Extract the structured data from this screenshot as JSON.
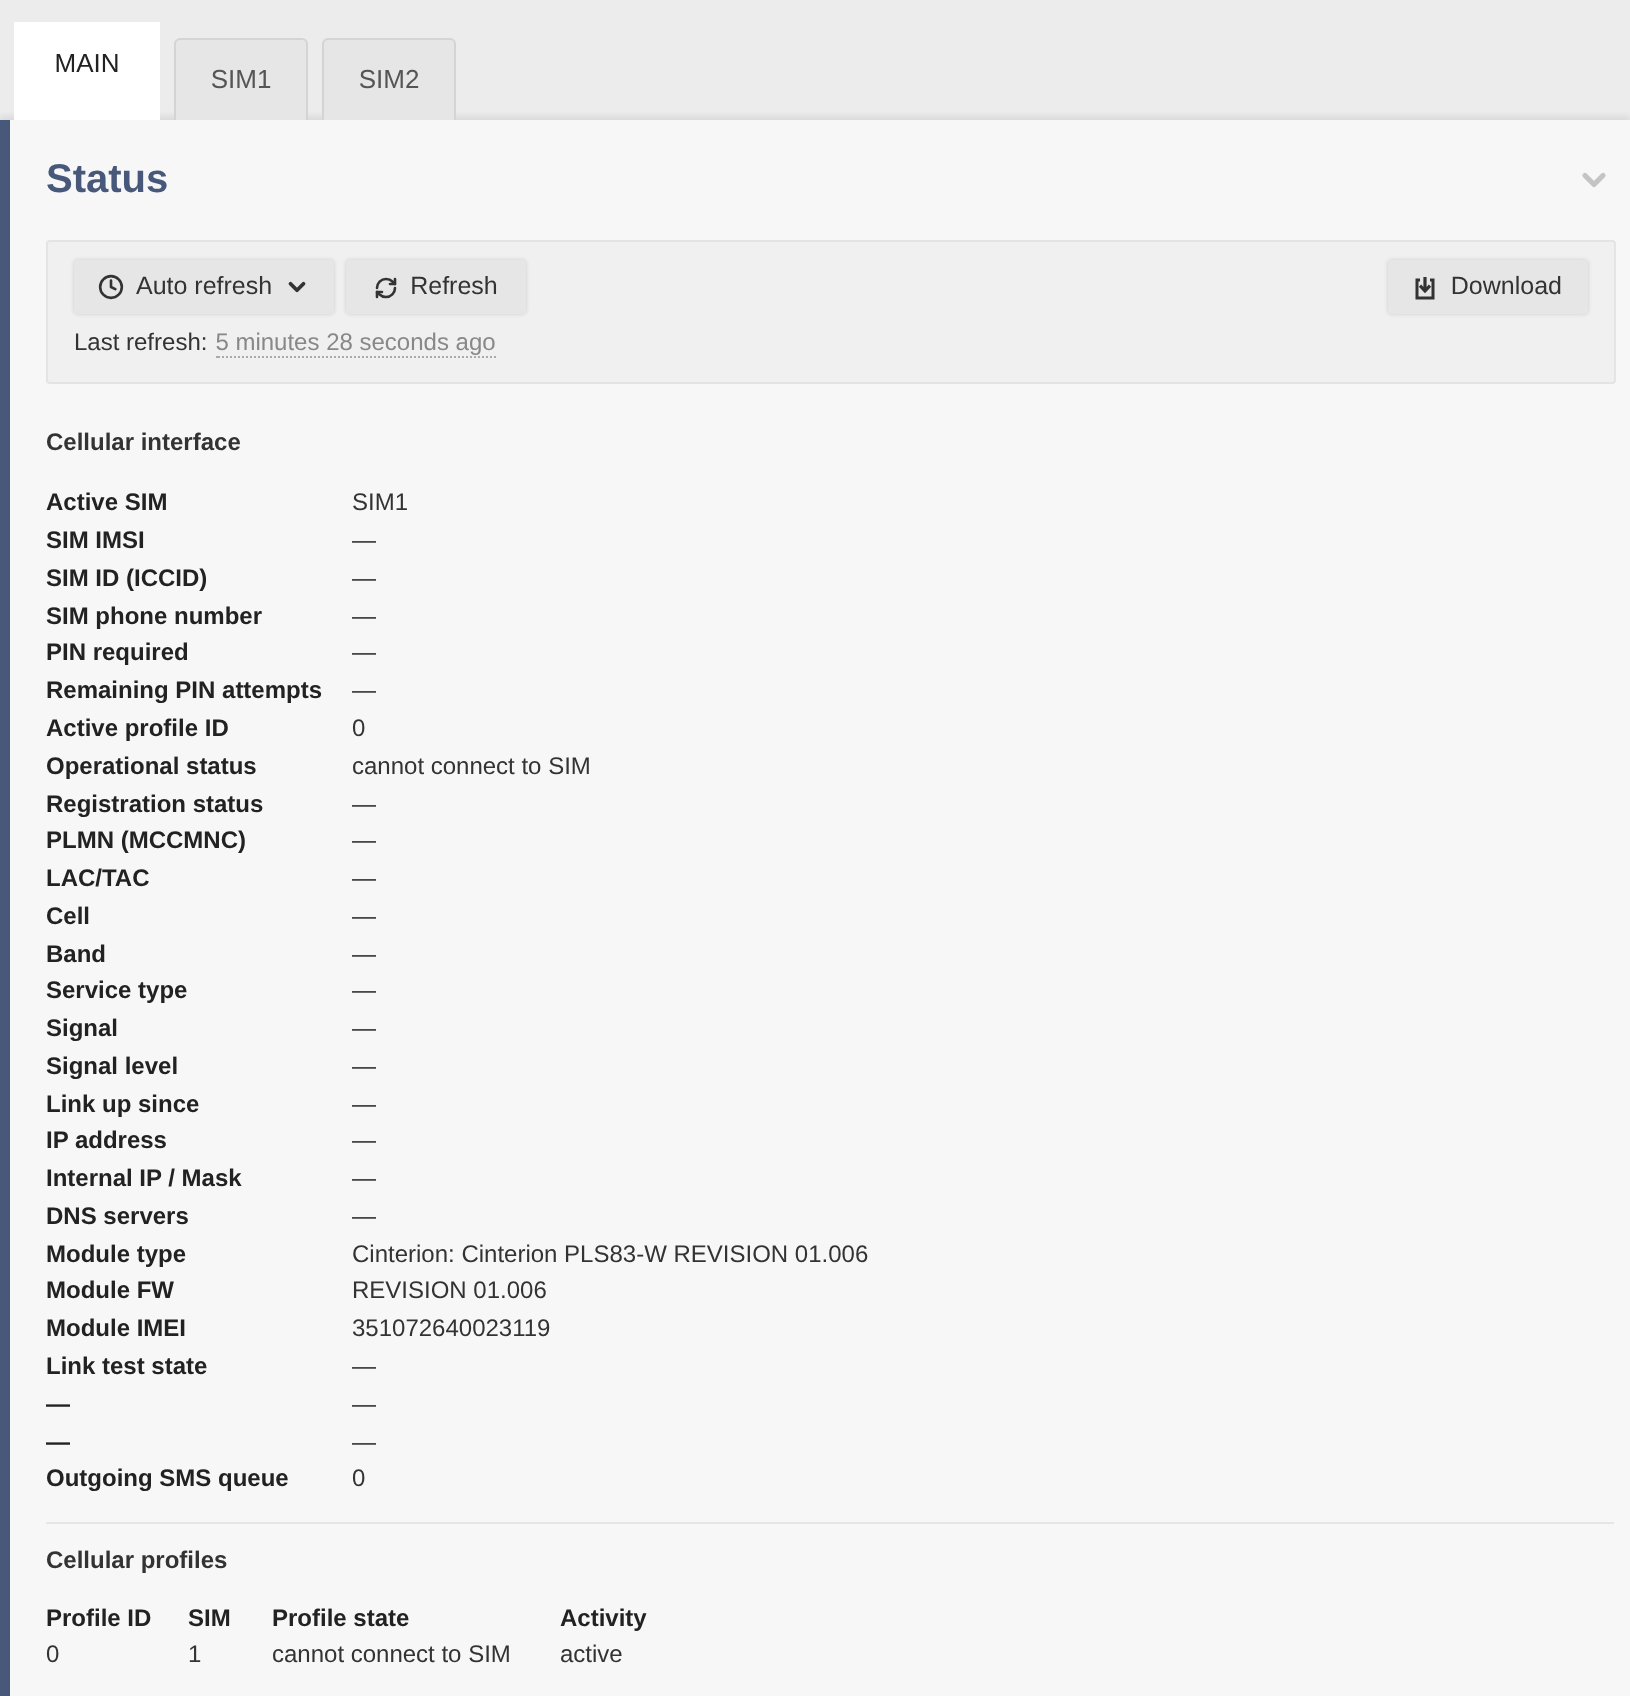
{
  "tabs": [
    {
      "label": "MAIN",
      "selected": true
    },
    {
      "label": "SIM1",
      "selected": false
    },
    {
      "label": "SIM2",
      "selected": false
    }
  ],
  "section": {
    "title": "Status",
    "expanded": true
  },
  "toolbar": {
    "auto_refresh": "Auto refresh",
    "refresh": "Refresh",
    "download": "Download",
    "last_refresh_label": "Last refresh:",
    "last_refresh_value": "5 minutes 28 seconds ago"
  },
  "cellular_interface": {
    "title": "Cellular interface",
    "rows": [
      {
        "label": "Active SIM",
        "value": "SIM1"
      },
      {
        "label": "SIM IMSI",
        "value": "—"
      },
      {
        "label": "SIM ID (ICCID)",
        "value": "—"
      },
      {
        "label": "SIM phone number",
        "value": "—"
      },
      {
        "label": "PIN required",
        "value": "—"
      },
      {
        "label": "Remaining PIN attempts",
        "value": "—"
      },
      {
        "label": "Active profile ID",
        "value": "0"
      },
      {
        "label": "Operational status",
        "value": "cannot connect to SIM"
      },
      {
        "label": "Registration status",
        "value": "—"
      },
      {
        "label": "PLMN (MCCMNC)",
        "value": "—"
      },
      {
        "label": "LAC/TAC",
        "value": "—"
      },
      {
        "label": "Cell",
        "value": "—"
      },
      {
        "label": "Band",
        "value": "—"
      },
      {
        "label": "Service type",
        "value": "—"
      },
      {
        "label": "Signal",
        "value": "—"
      },
      {
        "label": "Signal level",
        "value": "—"
      },
      {
        "label": "Link up since",
        "value": "—"
      },
      {
        "label": "IP address",
        "value": "—"
      },
      {
        "label": "Internal IP / Mask",
        "value": "—"
      },
      {
        "label": "DNS servers",
        "value": "—"
      },
      {
        "label": "Module type",
        "value": "Cinterion: Cinterion PLS83-W REVISION 01.006"
      },
      {
        "label": "Module FW",
        "value": "REVISION 01.006"
      },
      {
        "label": "Module IMEI",
        "value": "351072640023119"
      },
      {
        "label": "Link test state",
        "value": "—"
      },
      {
        "label": "—",
        "value": "—"
      },
      {
        "label": "—",
        "value": "—"
      },
      {
        "label": "Outgoing SMS queue",
        "value": "0"
      }
    ]
  },
  "cellular_profiles": {
    "title": "Cellular profiles",
    "columns": [
      "Profile ID",
      "SIM",
      "Profile state",
      "Activity"
    ],
    "rows": [
      [
        "0",
        "1",
        "cannot connect to SIM",
        "active"
      ]
    ]
  }
}
